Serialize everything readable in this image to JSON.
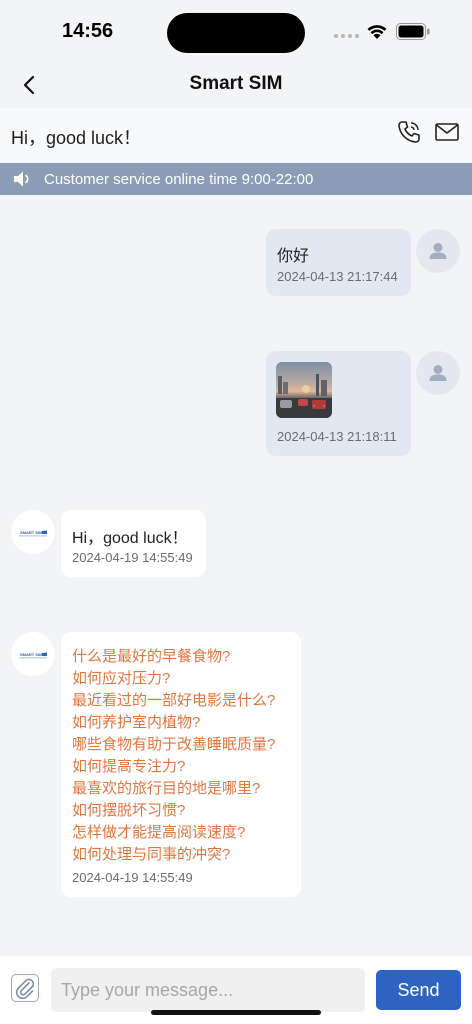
{
  "status_bar": {
    "time": "14:56"
  },
  "nav": {
    "title": "Smart SIM"
  },
  "header": {
    "greeting": "Hi，good luck！"
  },
  "notice": {
    "text": "Customer service online time 9:00-22:00"
  },
  "messages": [
    {
      "side": "right",
      "type": "text",
      "text": "你好",
      "time": "2024-04-13 21:17:44"
    },
    {
      "side": "right",
      "type": "image",
      "time": "2024-04-13 21:18:11"
    },
    {
      "side": "left",
      "type": "text",
      "text": "Hi，good luck！",
      "time": "2024-04-19 14:55:49"
    },
    {
      "side": "left",
      "type": "faq",
      "time": "2024-04-19 14:55:49",
      "items": [
        "什么是最好的早餐食物?",
        "如何应对压力?",
        "最近看过的一部好电影是什么?",
        "如何养护室内植物?",
        "哪些食物有助于改善睡眠质量?",
        "如何提高专注力?",
        "最喜欢的旅行目的地是哪里?",
        "如何摆脱坏习惯?",
        "怎样做才能提高阅读速度?",
        "如何处理与同事的冲突?"
      ]
    }
  ],
  "bot_logo_text": "SMART SIM",
  "input": {
    "placeholder": "Type your message...",
    "value": ""
  },
  "send_label": "Send",
  "colors": {
    "accent": "#2f63c1",
    "faq_text": "#e2763f",
    "notice_bg": "#8a9db4"
  }
}
